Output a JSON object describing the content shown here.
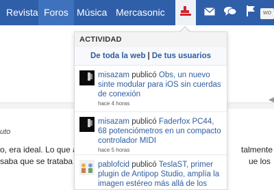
{
  "nav": {
    "items": [
      {
        "label": "Revista",
        "active": false
      },
      {
        "label": "Foros",
        "active": true
      },
      {
        "label": "Música",
        "active": false
      },
      {
        "label": "Mercasonic",
        "active": false
      }
    ],
    "icons": [
      "activity-icon",
      "mail-icon",
      "chat-icon",
      "flag-icon"
    ],
    "badge": "WO",
    "color_bar": "#2f5fa8",
    "color_active": "#3f72bd",
    "color_alert": "#d0242b"
  },
  "background": {
    "author_fragment": "uto",
    "line1_left": "o, era ideal. Lo que an",
    "line1_right": "talmente",
    "line2_left": "saba que se trataba de",
    "line2_right": "ue los"
  },
  "dropdown": {
    "title": "ACTIVIDAD",
    "filter_all": "De toda la web",
    "filter_sep": "|",
    "filter_users": "De tus usuarios",
    "items": [
      {
        "user": "misazam",
        "verb": "publicó",
        "link": "Obs, un nuevo sinte modular para iOS sin cuerdas de conexión",
        "time": "hace 4 horas"
      },
      {
        "user": "misazam",
        "verb": "publicó",
        "link": "Faderfox PC44, 68 potenciómetros en un compacto controlador MIDI",
        "time": "hace 5 horas"
      },
      {
        "user": "pablofcid",
        "verb": "publicó",
        "link": "TeslaST, primer plugin de Antipop Studio, amplía la imagen estéreo más allá de los",
        "time": ""
      }
    ],
    "link_color": "#2e5c9f"
  }
}
